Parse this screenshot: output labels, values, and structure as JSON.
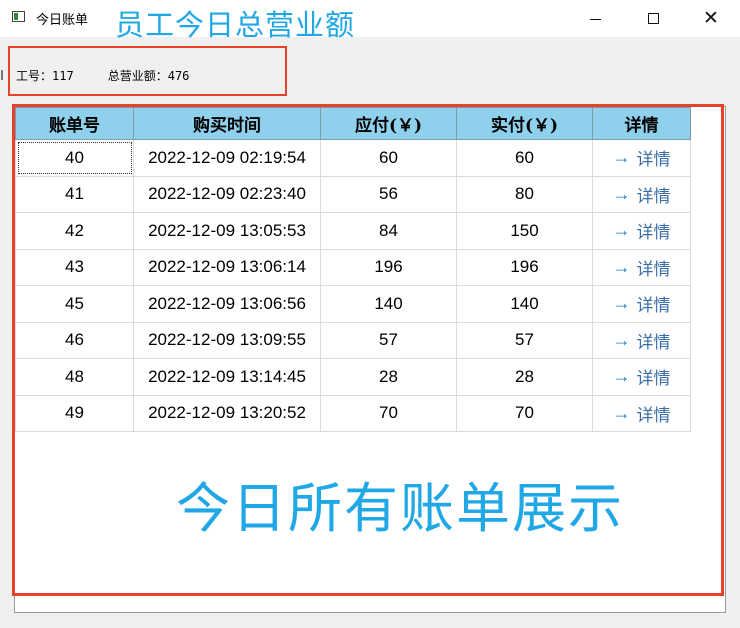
{
  "window": {
    "title": "今日账单"
  },
  "annotations": {
    "title": "员工今日总营业额",
    "caption": "今日所有账单展示"
  },
  "info": {
    "id_label": "工号：",
    "id_value": "117",
    "total_label": "总营业额：",
    "total_value": "476"
  },
  "table": {
    "headers": [
      "账单号",
      "购买时间",
      "应付(￥)",
      "实付(￥)",
      "详情"
    ],
    "rows": [
      {
        "id": "40",
        "time": "2022-12-09 02:19:54",
        "due": "60",
        "paid": "60",
        "detail": "详情"
      },
      {
        "id": "41",
        "time": "2022-12-09 02:23:40",
        "due": "56",
        "paid": "80",
        "detail": "详情"
      },
      {
        "id": "42",
        "time": "2022-12-09 13:05:53",
        "due": "84",
        "paid": "150",
        "detail": "详情"
      },
      {
        "id": "43",
        "time": "2022-12-09 13:06:14",
        "due": "196",
        "paid": "196",
        "detail": "详情"
      },
      {
        "id": "45",
        "time": "2022-12-09 13:06:56",
        "due": "140",
        "paid": "140",
        "detail": "详情"
      },
      {
        "id": "46",
        "time": "2022-12-09 13:09:55",
        "due": "57",
        "paid": "57",
        "detail": "详情"
      },
      {
        "id": "48",
        "time": "2022-12-09 13:14:45",
        "due": "28",
        "paid": "28",
        "detail": "详情"
      },
      {
        "id": "49",
        "time": "2022-12-09 13:20:52",
        "due": "70",
        "paid": "70",
        "detail": "详情"
      }
    ]
  },
  "colors": {
    "annotation_red": "#e8402a",
    "annotation_blue": "#1fa7e6",
    "header_bg": "#8fd0ec",
    "link_blue": "#3a6ea8"
  },
  "icons": {
    "app": "window-app-icon",
    "detail": "arrow-right-icon",
    "minimize": "minimize-icon",
    "maximize": "maximize-icon",
    "close": "close-icon"
  }
}
